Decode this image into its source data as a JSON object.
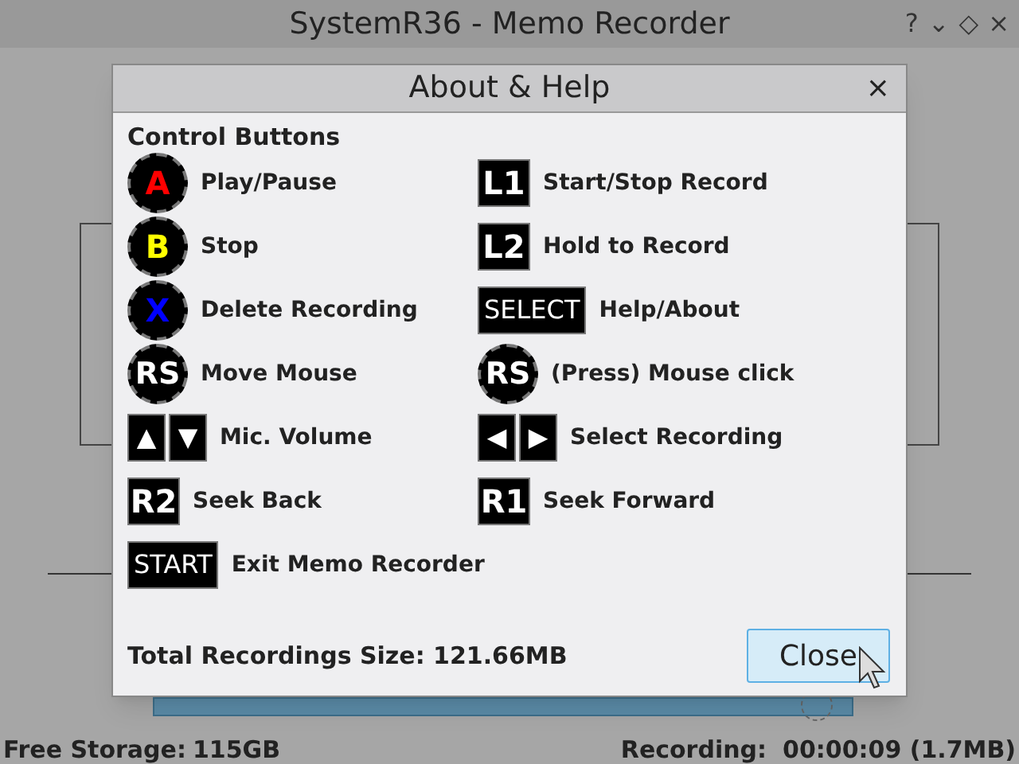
{
  "window": {
    "title": "SystemR36 - Memo Recorder",
    "controls": [
      "?",
      "⌄",
      "◇",
      "×"
    ]
  },
  "progress": {
    "level": 0.95
  },
  "status_bar": {
    "storage_label": "Free Storage:",
    "storage_value": "115GB",
    "recording_label": "Recording:",
    "recording_value": "00:00:09 (1.7MB)"
  },
  "dialog": {
    "title": "About & Help",
    "close_glyph": "×",
    "heading": "Control Buttons",
    "rows": [
      [
        {
          "kind": "circle",
          "keys": [
            "A"
          ],
          "color": "#ff0000",
          "action": "Play/Pause"
        },
        {
          "kind": "square",
          "keys": [
            "L1"
          ],
          "action": "Start/Stop Record"
        }
      ],
      [
        {
          "kind": "circle",
          "keys": [
            "B"
          ],
          "color": "#ffff00",
          "action": "Stop"
        },
        {
          "kind": "square",
          "keys": [
            "L2"
          ],
          "action": "Hold to Record"
        }
      ],
      [
        {
          "kind": "circle",
          "keys": [
            "X"
          ],
          "color": "#0000ff",
          "action": "Delete Recording"
        },
        {
          "kind": "wide",
          "keys": [
            "SELECT"
          ],
          "action": "Help/About"
        }
      ],
      [
        {
          "kind": "circle",
          "keys": [
            "RS"
          ],
          "color": "#ffffff",
          "action": "Move Mouse"
        },
        {
          "kind": "circle",
          "keys": [
            "RS"
          ],
          "color": "#ffffff",
          "action": "(Press) Mouse click"
        }
      ],
      [
        {
          "kind": "square",
          "keys": [
            "▲",
            "▼"
          ],
          "action": "Mic. Volume"
        },
        {
          "kind": "square",
          "keys": [
            "◀",
            "▶"
          ],
          "action": "Select Recording"
        }
      ],
      [
        {
          "kind": "square",
          "keys": [
            "R2"
          ],
          "action": "Seek Back"
        },
        {
          "kind": "square",
          "keys": [
            "R1"
          ],
          "action": "Seek Forward"
        }
      ],
      [
        {
          "kind": "wide",
          "keys": [
            "START"
          ],
          "action": "Exit Memo Recorder"
        }
      ]
    ],
    "total": "Total Recordings Size: 121.66MB",
    "button": "Close"
  }
}
